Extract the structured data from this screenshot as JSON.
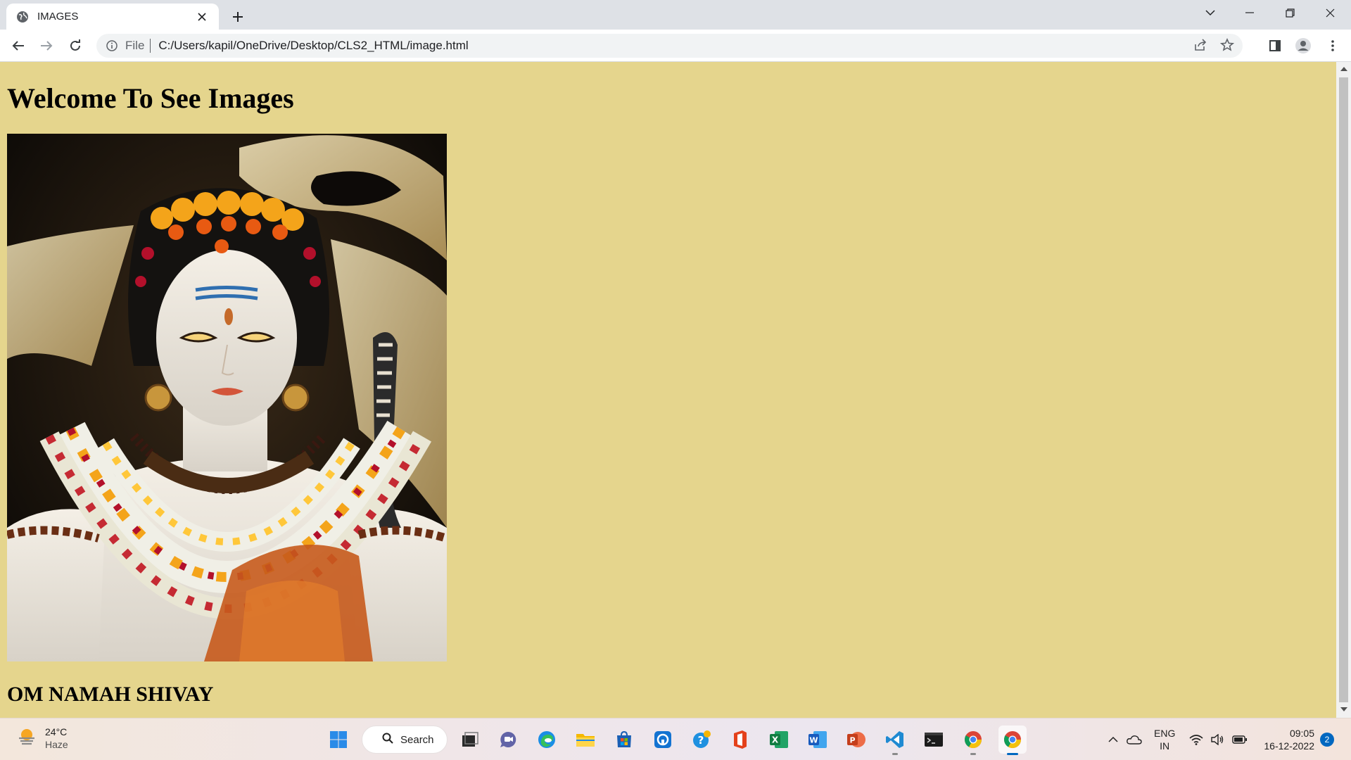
{
  "browser": {
    "tab": {
      "title": "IMAGES"
    },
    "address": {
      "scheme": "File",
      "url": "C:/Users/kapil/OneDrive/Desktop/CLS2_HTML/image.html"
    }
  },
  "page": {
    "heading": "Welcome To See Images",
    "image_alt": "Lord Shiva idol adorned with marigold garlands and a cobra",
    "caption": "OM NAMAH SHIVAY",
    "background_color": "#e5d58d"
  },
  "taskbar": {
    "weather": {
      "temp": "24°C",
      "condition": "Haze"
    },
    "search_label": "Search",
    "language": {
      "line1": "ENG",
      "line2": "IN"
    },
    "clock": {
      "time": "09:05",
      "date": "16-12-2022"
    },
    "notifications": "2",
    "apps": [
      "start",
      "search",
      "task-view",
      "teams-chat",
      "edge",
      "file-explorer",
      "microsoft-store",
      "app",
      "get-help",
      "office",
      "excel",
      "word",
      "powerpoint",
      "vscode",
      "terminal",
      "chrome",
      "chrome-active"
    ]
  }
}
